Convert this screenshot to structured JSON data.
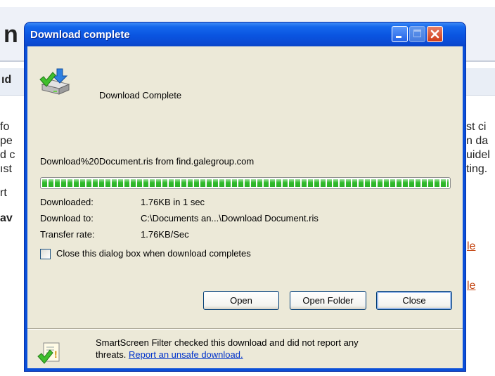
{
  "background_page": {
    "heading_letter": "n",
    "band_text": "ıd",
    "left_fragments": [
      " fo",
      "pe",
      "d c",
      "ıst",
      "rt",
      "av"
    ],
    "right_fragments": [
      "st ci",
      "n da",
      "uidel",
      "ting."
    ],
    "links": [
      "le",
      "le"
    ],
    "colors": {
      "header": "#eef1f8",
      "link": "#c2410c"
    }
  },
  "dialog": {
    "title": "Download complete",
    "titlebar_buttons": [
      "minimize-icon",
      "maximize-icon",
      "close-icon"
    ],
    "header_icon": "download-complete-icon",
    "header_text": "Download Complete",
    "file_line": "Download%20Document.ris from find.galegroup.com",
    "progress_fraction": 1.0,
    "rows": [
      {
        "label": "Downloaded:",
        "value": "1.76KB in 1 sec"
      },
      {
        "label": "Download to:",
        "value": "C:\\Documents an...\\Download Document.ris"
      },
      {
        "label": "Transfer rate:",
        "value": "1.76KB/Sec"
      }
    ],
    "close_when_done": {
      "label": "Close this dialog box when download completes",
      "checked": false
    },
    "buttons": {
      "open": "Open",
      "open_folder": "Open Folder",
      "close": "Close"
    },
    "smartscreen": {
      "icon": "smartscreen-shield-icon",
      "line1": "SmartScreen Filter checked this download and did not report any",
      "line2_prefix": "threats. ",
      "link": "Report an unsafe download."
    },
    "colors": {
      "titlebar": "#0a54e0",
      "client": "#ece9d8",
      "progress": "#2fba2b"
    }
  }
}
